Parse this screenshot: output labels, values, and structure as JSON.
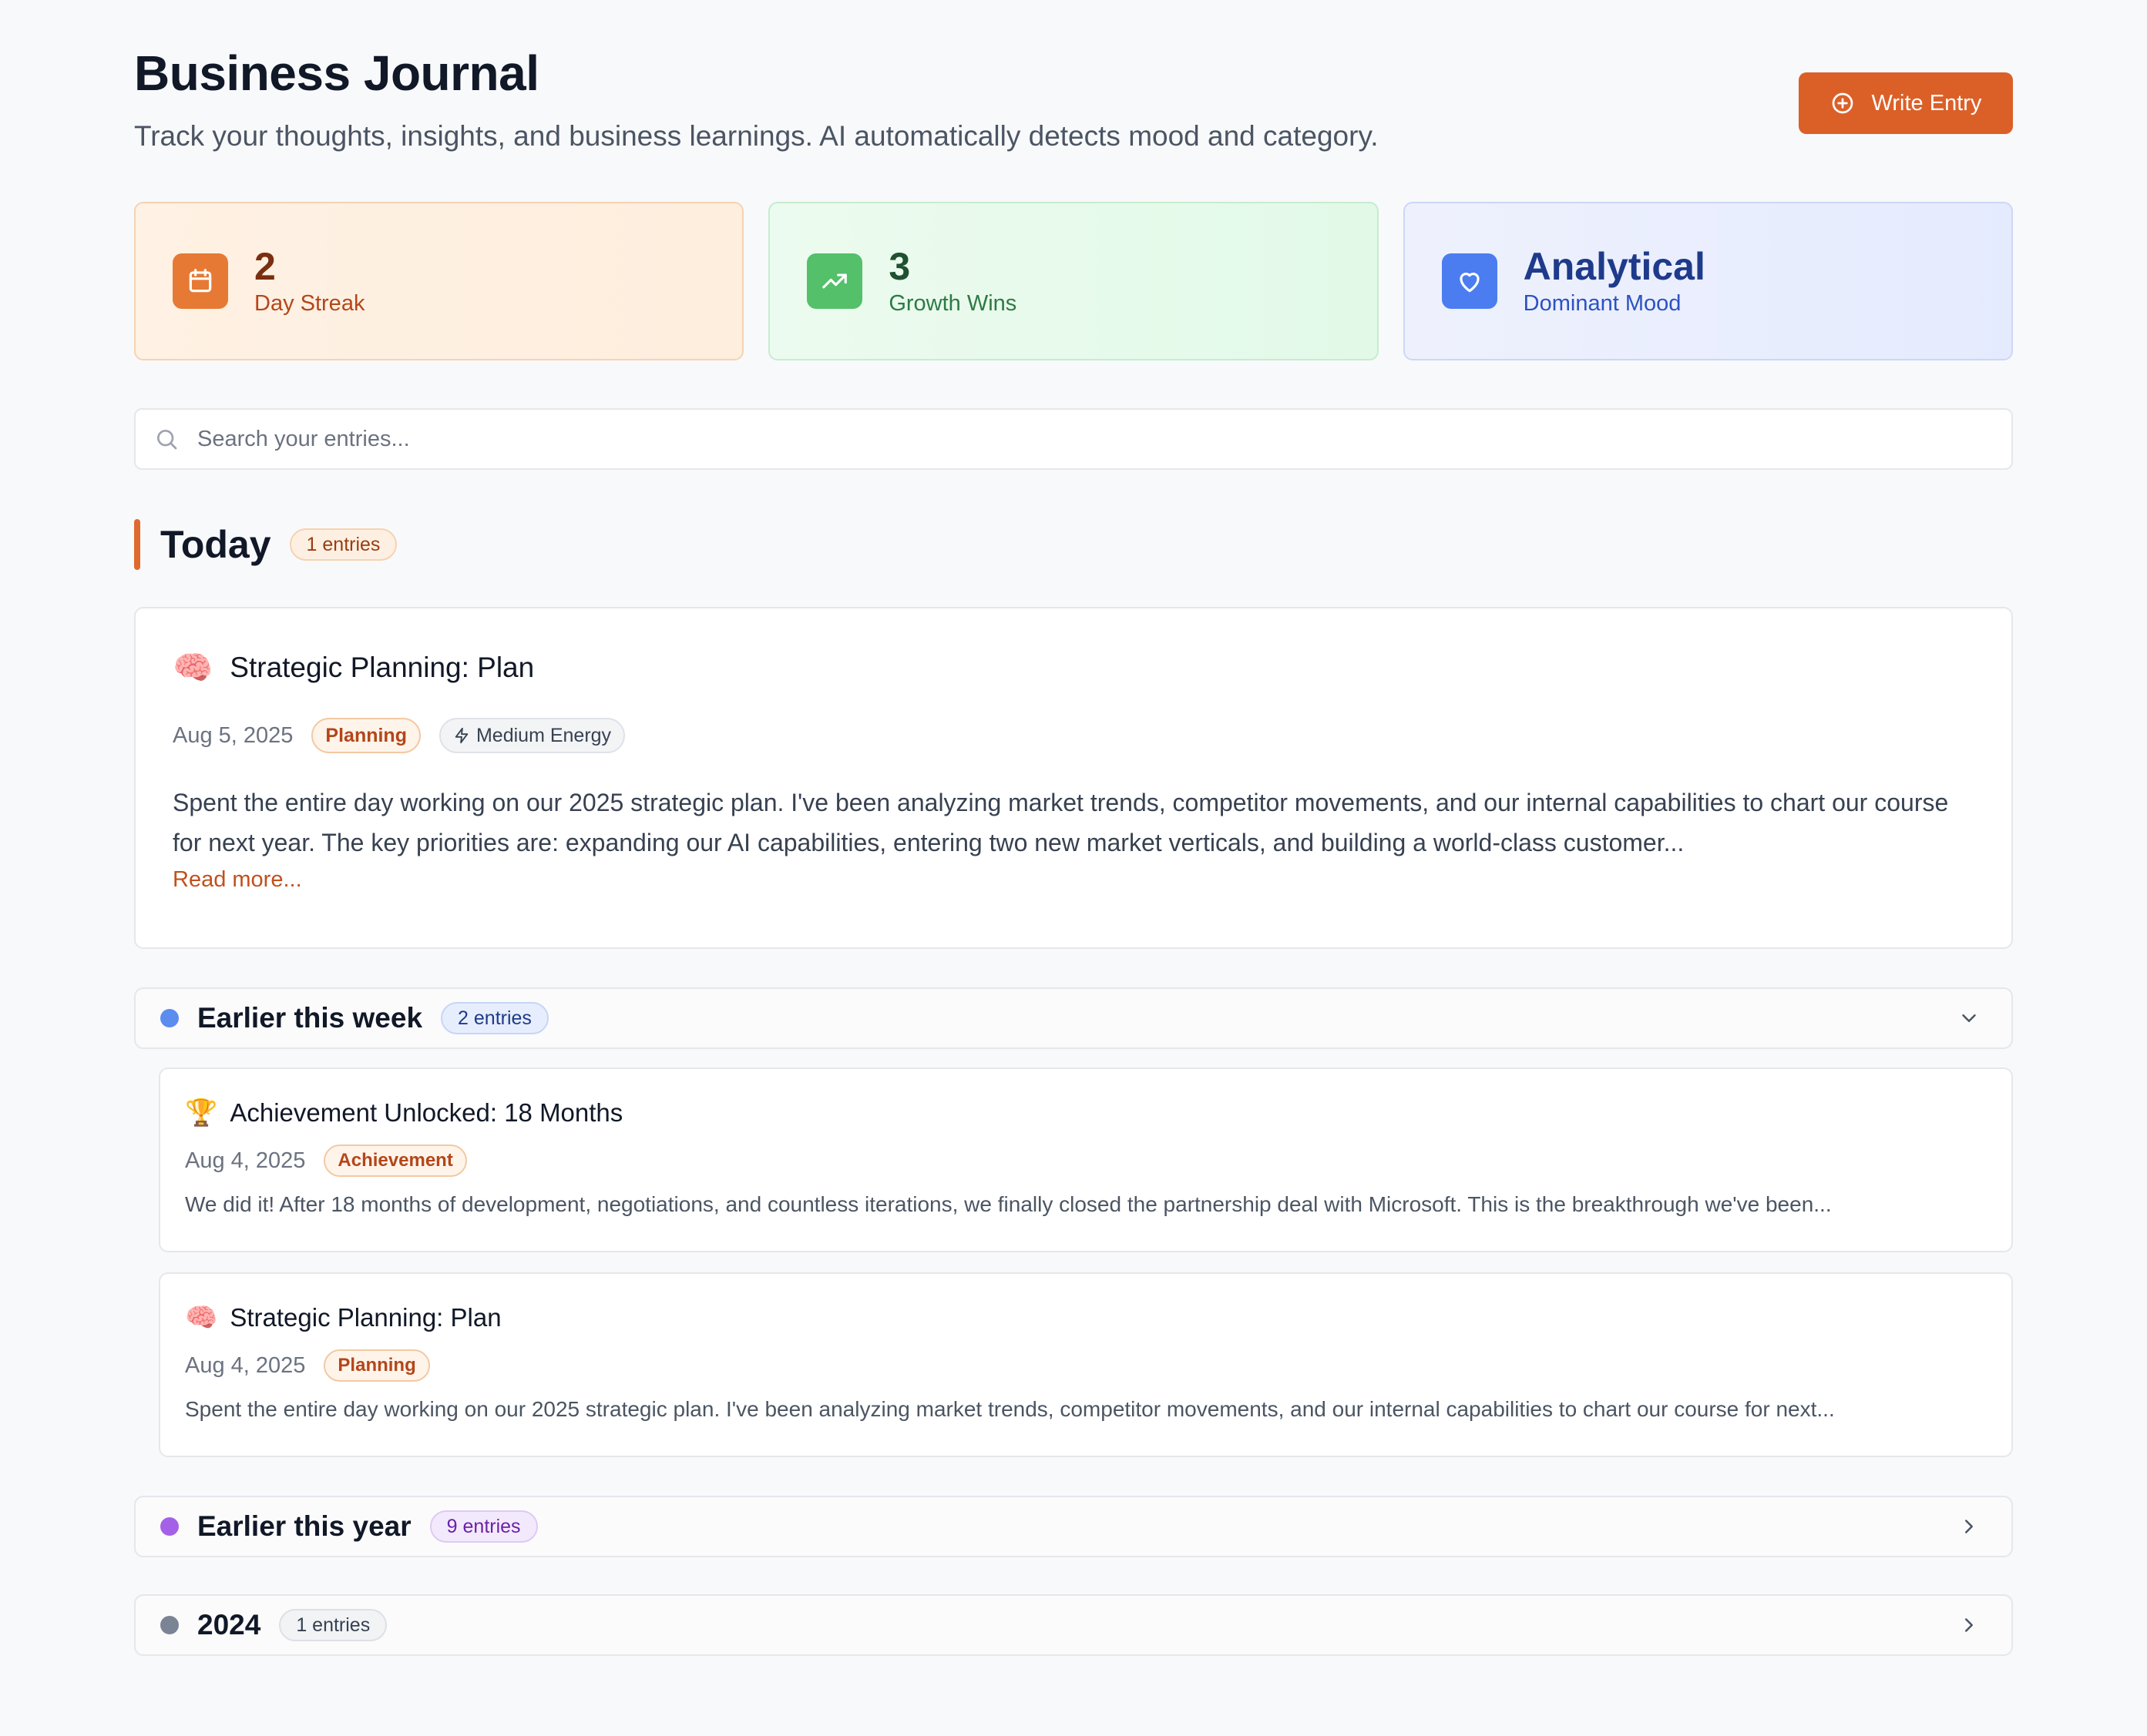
{
  "header": {
    "title": "Business Journal",
    "subtitle": "Track your thoughts, insights, and business learnings. AI automatically detects mood and category.",
    "write_label": "Write Entry"
  },
  "stats": [
    {
      "value": "2",
      "label": "Day Streak",
      "icon": "calendar-icon",
      "color": "#e67a34"
    },
    {
      "value": "3",
      "label": "Growth Wins",
      "icon": "trending-up-icon",
      "color": "#54c06a"
    },
    {
      "value": "Analytical",
      "label": "Dominant Mood",
      "icon": "heart-icon",
      "color": "#4b7df0"
    }
  ],
  "search": {
    "placeholder": "Search your entries...",
    "value": ""
  },
  "today": {
    "title": "Today",
    "count": "1 entries",
    "entry": {
      "emoji": "🧠",
      "title": "Strategic Planning: Plan",
      "date": "Aug 5, 2025",
      "category": "Planning",
      "energy": "Medium Energy",
      "body": "Spent the entire day working on our 2025 strategic plan. I've been analyzing market trends, competitor movements, and our internal capabilities to chart our course for next year. The key priorities are: expanding our AI capabilities, entering two new market verticals, and building a world-class customer...",
      "read_more": "Read more..."
    }
  },
  "groups": {
    "week": {
      "title": "Earlier this week",
      "count": "2 entries",
      "color": "#5b8def",
      "entries": [
        {
          "emoji": "🏆",
          "title": "Achievement Unlocked: 18 Months",
          "date": "Aug 4, 2025",
          "category": "Achievement",
          "body": "We did it! After 18 months of development, negotiations, and countless iterations, we finally closed the partnership deal with Microsoft. This is the breakthrough we've been..."
        },
        {
          "emoji": "🧠",
          "title": "Strategic Planning: Plan",
          "date": "Aug 4, 2025",
          "category": "Planning",
          "body": "Spent the entire day working on our 2025 strategic plan. I've been analyzing market trends, competitor movements, and our internal capabilities to chart our course for next..."
        }
      ]
    },
    "year": {
      "title": "Earlier this year",
      "count": "9 entries",
      "color": "#a461e8"
    },
    "y2024": {
      "title": "2024",
      "count": "1 entries",
      "color": "#7a8494"
    }
  }
}
